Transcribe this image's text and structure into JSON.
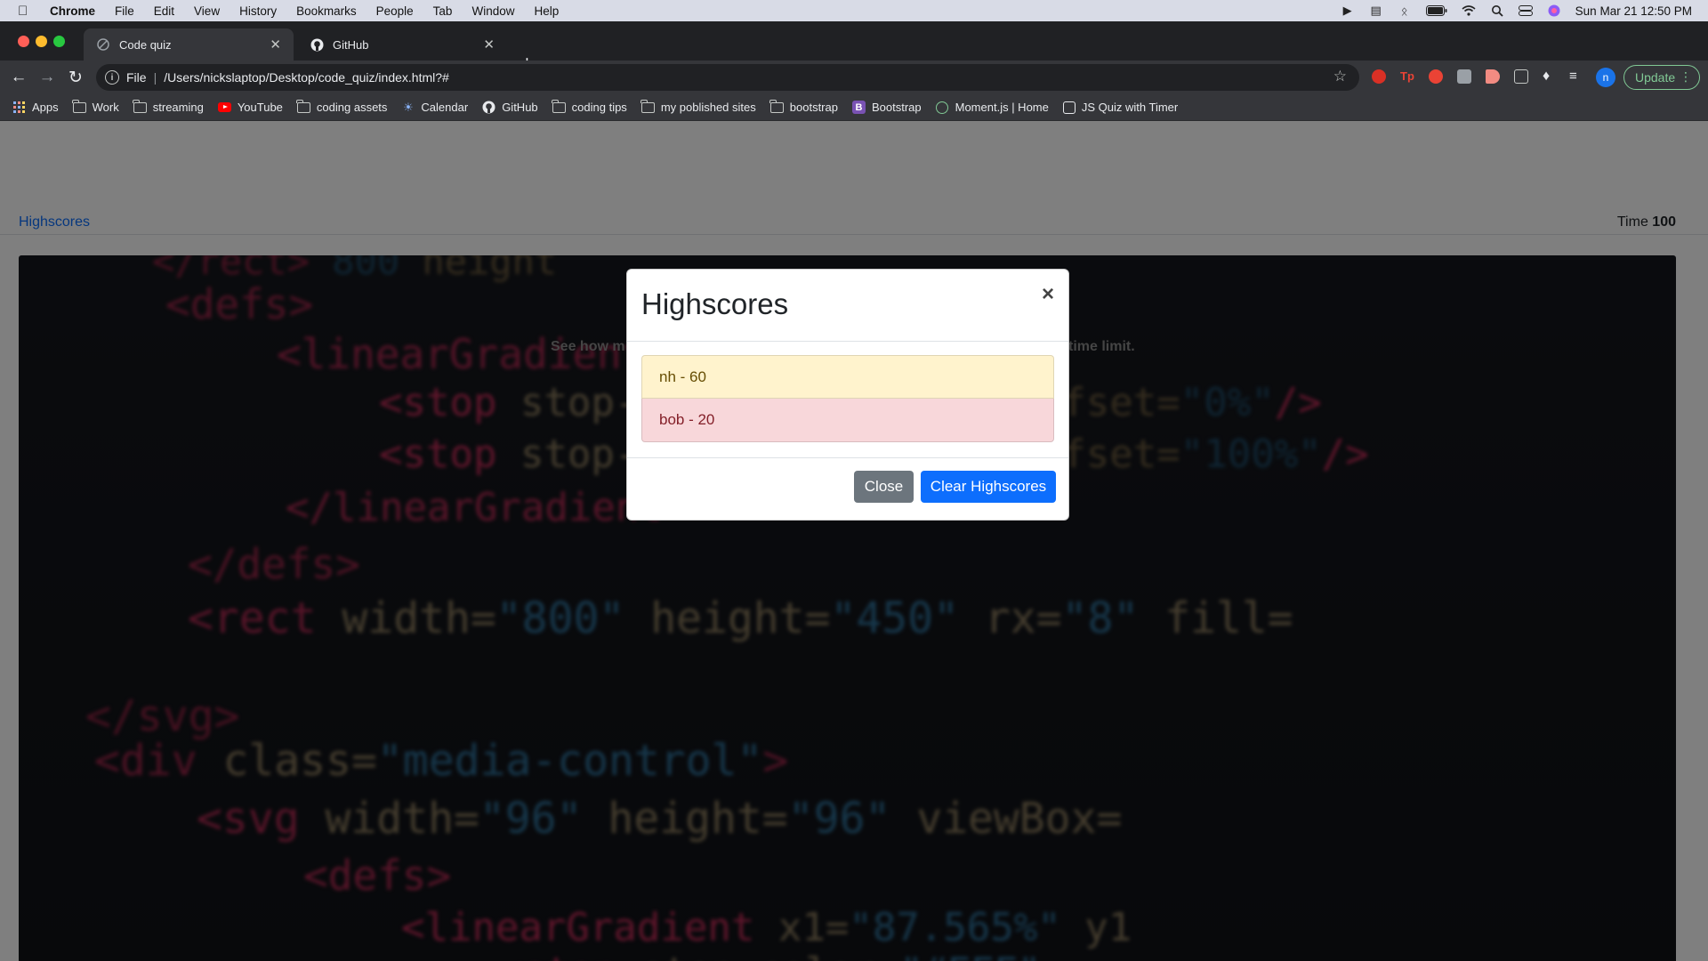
{
  "menubar": {
    "app": "Chrome",
    "items": [
      "File",
      "Edit",
      "View",
      "History",
      "Bookmarks",
      "People",
      "Tab",
      "Window",
      "Help"
    ],
    "datetime": "Sun Mar 21  12:50 PM"
  },
  "tabs": [
    {
      "title": "Code quiz",
      "active": true,
      "icon": "page-icon"
    },
    {
      "title": "GitHub",
      "active": false,
      "icon": "github-icon"
    }
  ],
  "address": {
    "scheme_label": "File",
    "url": "/Users/nickslaptop/Desktop/code_quiz/index.html?#"
  },
  "toolbar": {
    "update_label": "Update",
    "profile_initial": "n"
  },
  "bookmarks": [
    {
      "label": "Apps",
      "icon": "apps-grid-icon"
    },
    {
      "label": "Work",
      "icon": "folder-icon"
    },
    {
      "label": "streaming",
      "icon": "folder-icon"
    },
    {
      "label": "YouTube",
      "icon": "youtube-icon"
    },
    {
      "label": "coding assets",
      "icon": "folder-icon"
    },
    {
      "label": "Calendar",
      "icon": "calendar-icon"
    },
    {
      "label": "GitHub",
      "icon": "github-icon"
    },
    {
      "label": "coding tips",
      "icon": "folder-icon"
    },
    {
      "label": "my poblished sites",
      "icon": "folder-icon"
    },
    {
      "label": "bootstrap",
      "icon": "folder-icon"
    },
    {
      "label": "Bootstrap",
      "icon": "bootstrap-icon"
    },
    {
      "label": "Moment.js | Home",
      "icon": "moment-icon"
    },
    {
      "label": "JS Quiz with Timer",
      "icon": "quiz-icon"
    }
  ],
  "page": {
    "nav_link": "Highscores",
    "time_label": "Time",
    "time_value": "100",
    "hero_text_left": "See how m",
    "hero_text_right": "time limit."
  },
  "modal": {
    "title": "Highscores",
    "close_symbol": "×",
    "scores": [
      {
        "text": "nh - 60",
        "variant": "warning"
      },
      {
        "text": "bob - 20",
        "variant": "danger"
      }
    ],
    "close_button": "Close",
    "clear_button": "Clear Highscores"
  },
  "colors": {
    "primary": "#0d6efd",
    "secondary": "#6c757d",
    "warning_bg": "#fff3cd",
    "danger_bg": "#f8d7da"
  }
}
